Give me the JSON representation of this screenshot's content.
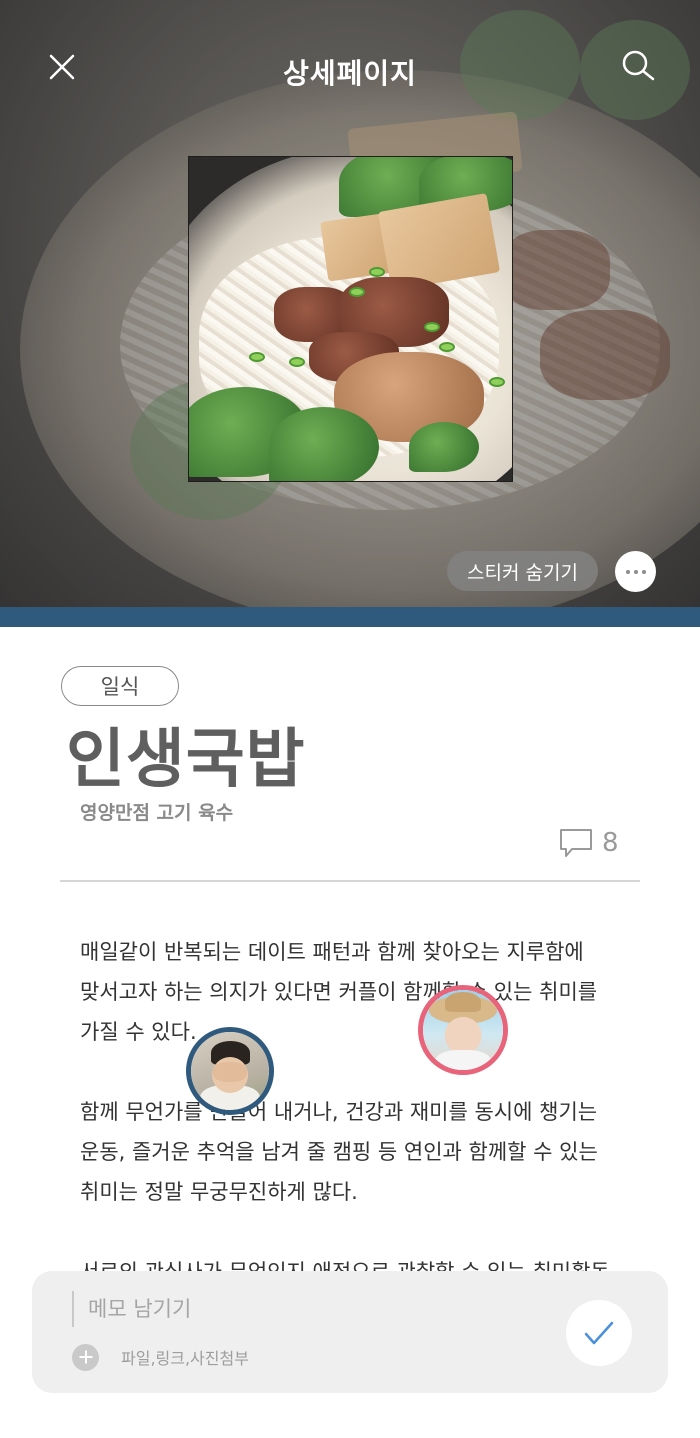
{
  "header": {
    "title": "상세페이지",
    "close_icon": "close-icon",
    "search_icon": "search-icon"
  },
  "hero": {
    "sticker_toggle_label": "스티커 숨기기",
    "more_icon": "more-icon",
    "accent_color": "#2f5a7e"
  },
  "post": {
    "category": "일식",
    "title": "인생국밥",
    "subtitle": "영양만점 고기 육수",
    "comment_icon": "comment-icon",
    "comment_count": "8",
    "paragraphs": [
      [
        "매일같이 반복되는 데이트 패턴과 함께 찾아오는 지루함에",
        "맞서고자 하는 의지가 있다면 커플이 함께할 수 있는 취미를",
        "가질 수 있다."
      ],
      [
        "함께 무언가를 만들어 내거나, 건강과 재미를 동시에 챙기는",
        "운동, 즐거운 추억을 남겨 줄 캠핑 등 연인과 함께할 수 있는",
        "취미는 정말 무궁무진하게 많다."
      ],
      [
        "서로의 관심사가 무엇인지 애정으로 관찰할 수 있는 취미활동"
      ]
    ]
  },
  "stickers": [
    {
      "name": "user-sticker-1",
      "ring_color": "#2f5a7e"
    },
    {
      "name": "user-sticker-2",
      "ring_color": "#e8647b"
    }
  ],
  "memo": {
    "placeholder": "메모 남기기",
    "attach_label": "파일,링크,사진첨부",
    "plus_icon": "plus-icon",
    "submit_icon": "check-icon",
    "submit_color": "#4a90d9"
  }
}
